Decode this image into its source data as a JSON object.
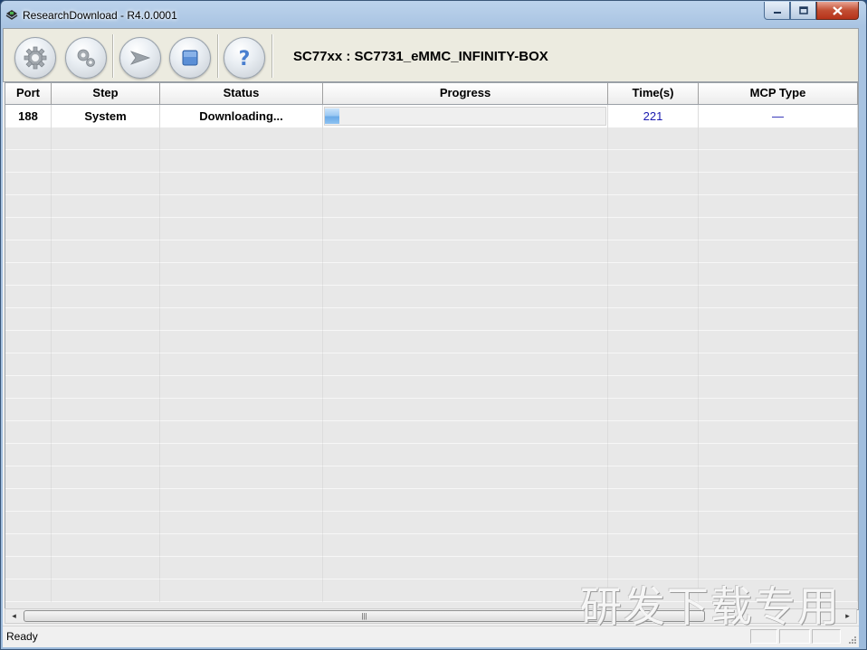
{
  "window": {
    "title": "ResearchDownload - R4.0.0001"
  },
  "toolbar": {
    "chip_label": "SC77xx : SC7731_eMMC_INFINITY-BOX",
    "buttons": [
      {
        "icon": "gear-icon"
      },
      {
        "icon": "gears-icon"
      },
      {
        "icon": "play-arrow-icon"
      },
      {
        "icon": "stop-icon"
      },
      {
        "icon": "help-icon"
      }
    ]
  },
  "grid": {
    "columns": [
      "Port",
      "Step",
      "Status",
      "Progress",
      "Time(s)",
      "MCP Type"
    ],
    "rows": [
      {
        "port": "188",
        "step": "System",
        "status": "Downloading...",
        "progress_fraction": 0.05,
        "time": "221",
        "mcp_type": "—"
      }
    ]
  },
  "statusbar": {
    "text": "Ready"
  },
  "watermark": "研发下载专用",
  "colors": {
    "time_text": "#1a1ab0",
    "progress_fill": "#6aaae8",
    "close_button": "#c24e33"
  }
}
